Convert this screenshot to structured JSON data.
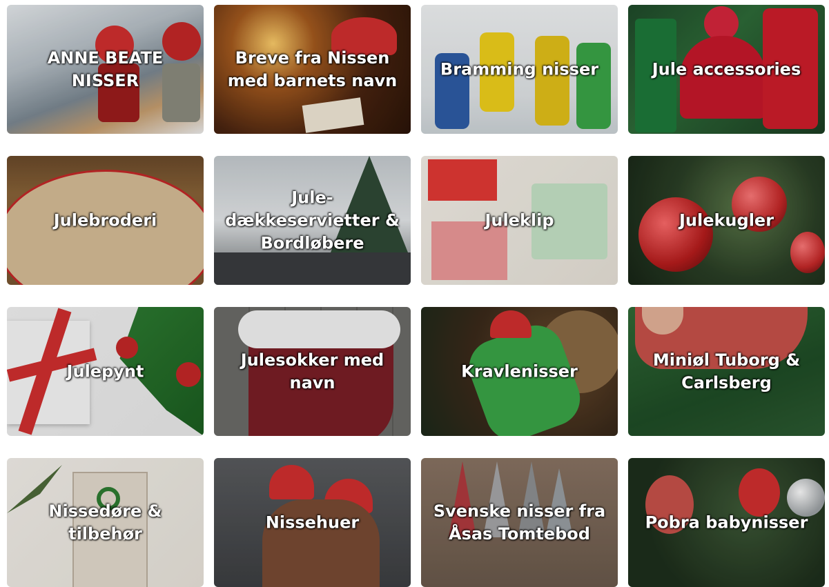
{
  "categories": [
    {
      "label": "ANNE BEATE NISSER",
      "image": "pair of red-hatted dolls in snowy forest",
      "accent": "#c62828"
    },
    {
      "label": "Breve fra Nissen med barnets navn",
      "image": "child in santa hat writing letter by candlelight",
      "accent": "#b71c1c"
    },
    {
      "label": "Bramming nisser",
      "image": "elf figurines in snow",
      "accent": "#d32f2f"
    },
    {
      "label": "Jule accessories",
      "image": "christmas bow tie, beanie and socks",
      "accent": "#c62828"
    },
    {
      "label": "Julebroderi",
      "image": "embroidered christmas tree skirt",
      "accent": "#c8a57a"
    },
    {
      "label": "Jule-dækkeservietter & Bordløbere",
      "image": "decorated dining table with christmas tree",
      "accent": "#90a4ae"
    },
    {
      "label": "Juleklip",
      "image": "christmas paper craft kits",
      "accent": "#e53935"
    },
    {
      "label": "Julekugler",
      "image": "red baubles on christmas tree",
      "accent": "#b71c1c"
    },
    {
      "label": "Julepynt",
      "image": "gift with red ribbon and pine branches",
      "accent": "#c62828"
    },
    {
      "label": "Julesokker med navn",
      "image": "personalized velvet christmas stocking",
      "accent": "#7b1f26"
    },
    {
      "label": "Kravlenisser",
      "image": "crawling elf decoration on wood ornament",
      "accent": "#fbc02d"
    },
    {
      "label": "Miniøl Tuborg & Carlsberg",
      "image": "elf figure lying on christmas tree",
      "accent": "#2e7d32"
    },
    {
      "label": "Nissedøre & tilbehør",
      "image": "miniature elf door with wreath",
      "accent": "#e0d6c6"
    },
    {
      "label": "Nissehuer",
      "image": "two children in santa hats",
      "accent": "#c62828"
    },
    {
      "label": "Svenske nisser fra Åsas Tomtebod",
      "image": "swedish gnomes on wooden shelf",
      "accent": "#8d6e63"
    },
    {
      "label": "Pobra babynisser",
      "image": "baby elf figurines by tree",
      "accent": "#c62828"
    }
  ]
}
